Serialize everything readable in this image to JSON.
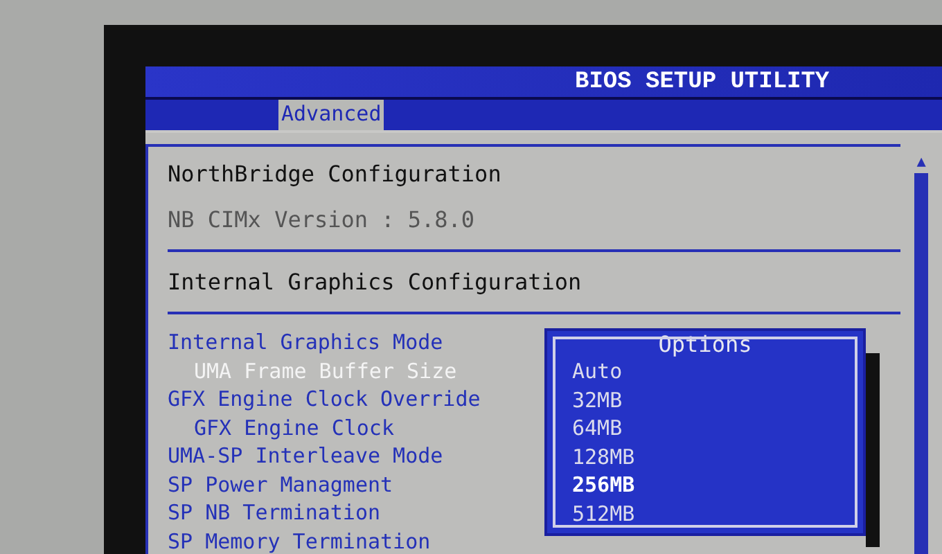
{
  "header": {
    "title": "BIOS SETUP UTILITY"
  },
  "tabs": [
    {
      "label": "Advanced",
      "selected": true
    }
  ],
  "sections": [
    {
      "title": "NorthBridge Configuration",
      "info": "NB CIMx Version : 5.8.0"
    },
    {
      "title": "Internal Graphics Configuration"
    }
  ],
  "items": [
    {
      "label": "Internal Graphics Mode",
      "selected": false,
      "children": [
        {
          "label": "UMA Frame Buffer Size",
          "selected": true
        }
      ]
    },
    {
      "label": "GFX Engine Clock Override",
      "selected": false,
      "children": [
        {
          "label": "GFX Engine Clock",
          "selected": false
        }
      ]
    },
    {
      "label": "UMA-SP Interleave Mode",
      "selected": false
    },
    {
      "label": "SP Power Managment",
      "selected": false
    },
    {
      "label": "SP NB Termination",
      "selected": false
    },
    {
      "label": "SP Memory Termination",
      "selected": false
    }
  ],
  "options_popup": {
    "title": "Options",
    "options": [
      {
        "label": "Auto",
        "selected": false
      },
      {
        "label": "32MB",
        "selected": false
      },
      {
        "label": "64MB",
        "selected": false
      },
      {
        "label": "128MB",
        "selected": false
      },
      {
        "label": "256MB",
        "selected": true
      },
      {
        "label": "512MB",
        "selected": false
      }
    ]
  },
  "scrollbar_up": "▲"
}
